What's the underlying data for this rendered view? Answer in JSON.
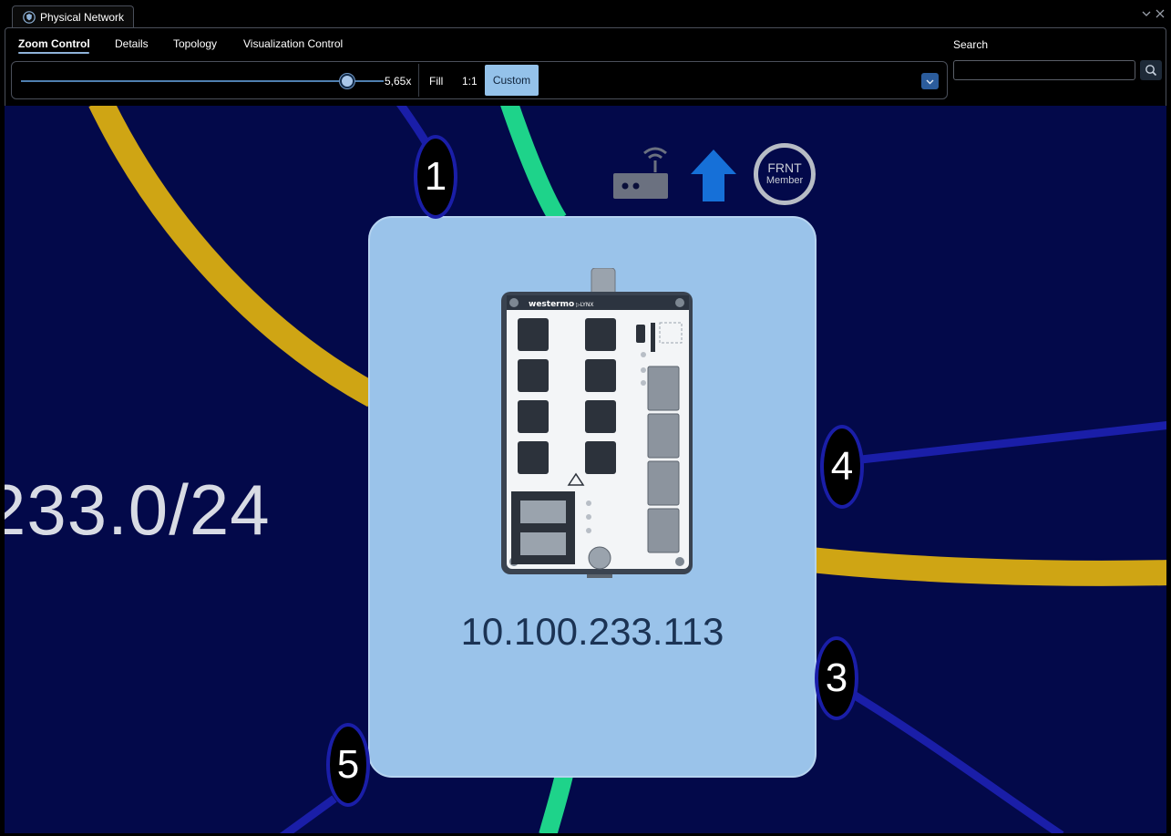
{
  "window": {
    "tab_title": "Physical Network"
  },
  "toolbar": {
    "tabs": [
      {
        "label": "Zoom Control",
        "active": true
      },
      {
        "label": "Details"
      },
      {
        "label": "Topology"
      },
      {
        "label": "Visualization Control"
      }
    ],
    "zoom": {
      "value_label": "5,65x",
      "slider_fraction": 0.9,
      "fill_label": "Fill",
      "one_to_one_label": "1:1",
      "custom_label": "Custom"
    },
    "search": {
      "label": "Search",
      "value": "",
      "placeholder": ""
    }
  },
  "topology": {
    "subnet_label": "233.0/24",
    "node": {
      "ip": "10.100.233.113",
      "status_icons": [
        "router-icon",
        "arrow-up-icon"
      ],
      "frnt_badge": {
        "top": "FRNT",
        "bottom": "Member"
      }
    },
    "port_badges": [
      {
        "label": "1"
      },
      {
        "label": "4"
      },
      {
        "label": "3"
      },
      {
        "label": "5"
      }
    ],
    "colors": {
      "canvas_bg": "#03094a",
      "link_yellow": "#cfa514",
      "link_green": "#1ed38a",
      "link_blue": "#1a1ea8",
      "card": "#9ac3ea",
      "accent": "#94c2ea"
    }
  }
}
